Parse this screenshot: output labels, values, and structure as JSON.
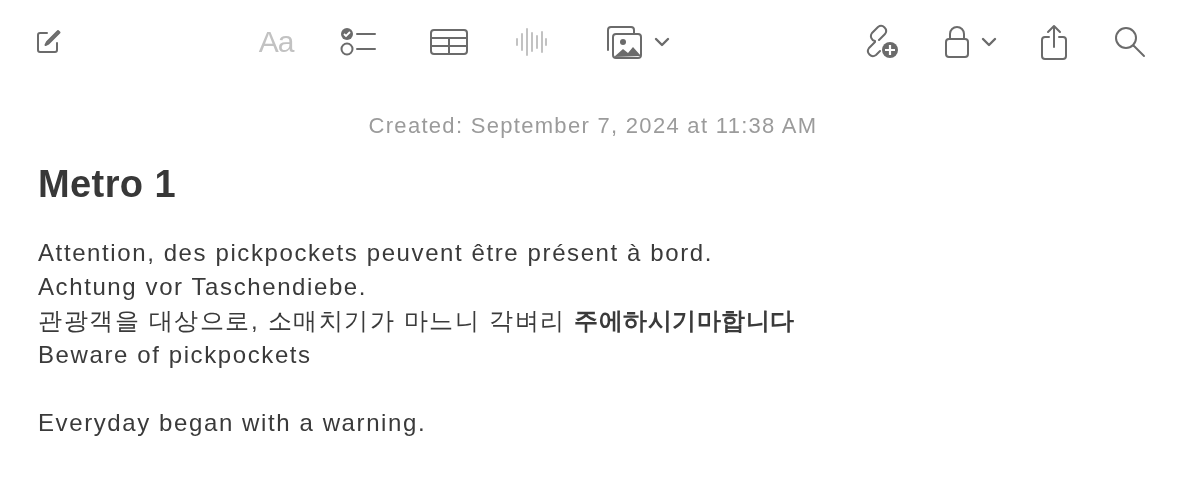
{
  "toolbar": {
    "items": [
      {
        "kind": "compose",
        "disabled": false,
        "menu": false
      },
      {
        "kind": "format",
        "label": "Aa",
        "disabled": true,
        "menu": false
      },
      {
        "kind": "checklist",
        "disabled": false,
        "menu": false
      },
      {
        "kind": "table",
        "disabled": false,
        "menu": false
      },
      {
        "kind": "audio",
        "disabled": true,
        "menu": false
      },
      {
        "kind": "media",
        "disabled": false,
        "menu": true
      },
      {
        "kind": "collaborate",
        "disabled": false,
        "menu": false
      },
      {
        "kind": "lock",
        "disabled": false,
        "menu": true
      },
      {
        "kind": "share",
        "disabled": false,
        "menu": false
      },
      {
        "kind": "search",
        "disabled": false,
        "menu": false
      }
    ]
  },
  "note": {
    "created": "Created: September 7, 2024 at 11:38 AM",
    "title": "Metro 1",
    "paragraphs": [
      {
        "lines": [
          "Attention, des pickpockets peuvent être présent à bord.",
          "Achtung vor Taschendiebe.",
          "관광객을 대상으로, 소매치기가 마느니 각벼리 **주에하시기마합니다**",
          "Beware of pickpockets"
        ]
      },
      {
        "lines": [
          "Everyday began with a warning."
        ]
      }
    ]
  }
}
